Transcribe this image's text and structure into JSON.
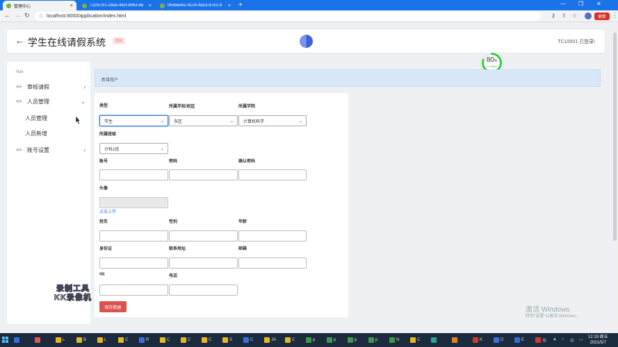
{
  "browser": {
    "tabs": [
      {
        "title": "管理中心",
        "active": true
      },
      {
        "title": "71cf57b1-28a5-46cf-8993-6e",
        "active": false
      },
      {
        "title": "065bee62-4124-4a53-87e2-8",
        "active": false
      }
    ],
    "url": "localhost:8000/application/index.html",
    "update_label": "更新"
  },
  "header": {
    "title": "学生在线请假系统",
    "badge": "前台",
    "user": "TC10001 已登录!"
  },
  "gauge": {
    "value": "80",
    "unit": "%",
    "sub": "↑ 0.2K/s",
    "fraction": 0.8
  },
  "sidebar": {
    "heading": "Nav",
    "items": [
      {
        "code": "<>",
        "label": "审核请假",
        "chevron": "›"
      },
      {
        "code": "<>",
        "label": "人员管理",
        "chevron": "⌄"
      },
      {
        "code": "<>",
        "label": "账号设置",
        "chevron": "›"
      }
    ],
    "subitems": [
      "人员管理",
      "人员新增"
    ]
  },
  "section": {
    "title": "新增用户"
  },
  "form": {
    "type_label": "类型",
    "type_value": "学生",
    "campus_label": "所属学校/校区",
    "campus_value": "东区",
    "college_label": "所属学院",
    "college_value": "计算机科学",
    "class_label": "所属班级",
    "class_value": "计科1班",
    "account_label": "账号",
    "password_label": "密码",
    "confirm_label": "确认密码",
    "avatar_label": "头像",
    "upload_link": "点击上传",
    "name_label": "姓名",
    "gender_label": "性别",
    "age_label": "年龄",
    "idcard_label": "身份证",
    "address_label": "联系地址",
    "email_label": "邮箱",
    "qq_label": "qq",
    "phone_label": "电话",
    "save_label": "保存数据"
  },
  "overlay": {
    "watermark_line1": "录制工具",
    "watermark_line2": "KK录像机",
    "activate_title": "激活 Windows",
    "activate_sub": "转到\"设置\"以激活 Windows。"
  },
  "taskbar": {
    "apps": [
      {
        "label": "",
        "color": "#2f6fd6"
      },
      {
        "label": "",
        "color": "#e2574c"
      },
      {
        "label": "L",
        "color": "#e8b624"
      },
      {
        "label": "B",
        "color": "#e8b624"
      },
      {
        "label": "L",
        "color": "#e8b624"
      },
      {
        "label": "C",
        "color": "#e8b624"
      },
      {
        "label": "R",
        "color": "#3a6fd8"
      },
      {
        "label": "C",
        "color": "#e8b624"
      },
      {
        "label": "C",
        "color": "#e8b624"
      },
      {
        "label": "C",
        "color": "#e8b624"
      },
      {
        "label": "S",
        "color": "#e8b624"
      },
      {
        "label": "C",
        "color": "#3a6fd8"
      },
      {
        "label": "JA",
        "color": "#e8b624"
      },
      {
        "label": "C",
        "color": "#e8b624"
      },
      {
        "label": "p",
        "color": "#3a9a48"
      },
      {
        "label": "p",
        "color": "#3a9a48"
      },
      {
        "label": "p",
        "color": "#3a9a48"
      },
      {
        "label": "p",
        "color": "#3a9a48"
      },
      {
        "label": "N",
        "color": "#3a9a48"
      },
      {
        "label": "C",
        "color": "#e8b624"
      },
      {
        "label": "",
        "color": "#2aa198"
      },
      {
        "label": "",
        "color": "#e0831f"
      },
      {
        "label": "K",
        "color": "#d03a2a"
      },
      {
        "label": "D",
        "color": "#3a6fd8"
      },
      {
        "label": "E",
        "color": "#2f6fd6"
      },
      {
        "label": "华",
        "color": "#d03a2a"
      }
    ],
    "time": "12:19 周五",
    "date": "2021/5/7"
  }
}
